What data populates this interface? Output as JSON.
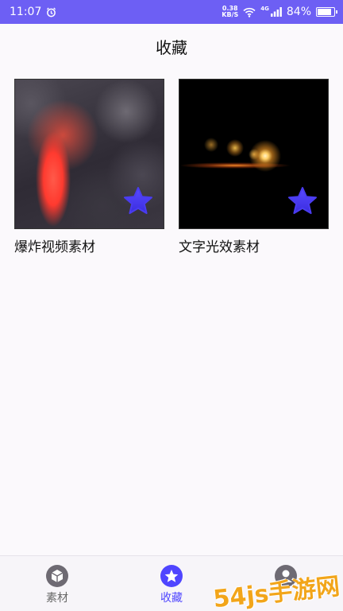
{
  "status_bar": {
    "time": "11:07",
    "speed_value": "0.38",
    "speed_unit": "KB/S",
    "network_gen": "4G",
    "battery": "84%",
    "battery_level": 0.84
  },
  "header": {
    "title": "收藏"
  },
  "favorites": [
    {
      "label": "爆炸视频素材",
      "favorited": true
    },
    {
      "label": "文字光效素材",
      "favorited": true
    }
  ],
  "bottom_nav": {
    "items": [
      {
        "label": "素材",
        "icon": "cube-icon",
        "active": false
      },
      {
        "label": "收藏",
        "icon": "star-icon",
        "active": true
      },
      {
        "label": "",
        "icon": "person-icon",
        "active": false
      }
    ]
  },
  "watermark": {
    "text": "54js手游网"
  },
  "colors": {
    "accent": "#4f45ff",
    "status_bar": "#6d5ff4",
    "star": "#4a3cf0"
  }
}
